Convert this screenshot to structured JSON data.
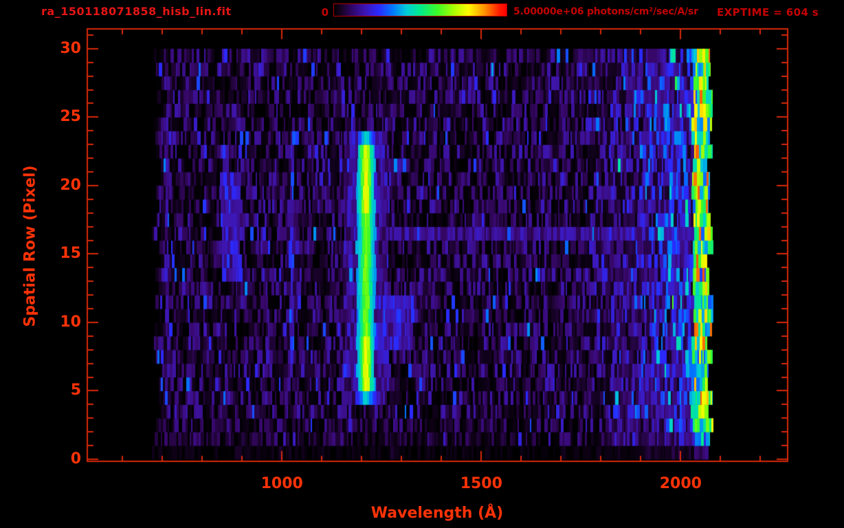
{
  "colors": {
    "background": "#000000",
    "axis": "#d8280a",
    "tick_label": "#fb3208",
    "title": "#e51515",
    "annotation": "#c40202"
  },
  "chart_data": {
    "type": "heatmap",
    "title": "ra_150118071858_hisb_lin.fit",
    "xlabel": "Wavelength (Å)",
    "ylabel": "Spatial Row (Pixel)",
    "xlim": [
      510,
      2270
    ],
    "ylim": [
      -0.2,
      31.5
    ],
    "xticks_major": [
      1000,
      1500,
      2000
    ],
    "xticks_minor_step": 100,
    "xticks_minor_range": [
      600,
      2200
    ],
    "yticks_major": [
      0,
      5,
      10,
      15,
      20,
      25,
      30
    ],
    "yticks_minor_step": 1,
    "yticks_minor_range": [
      0,
      31
    ],
    "grid": false,
    "plot_background": "#000000",
    "colorbar": {
      "min_label": "0",
      "max_label": "5.00000e+06",
      "units": "photons/cm²/sec/A/sr",
      "palette": "rainbow (black-purple-blue-cyan-green-yellow-red)"
    },
    "exptime_label": "EXPTIME = 604 s",
    "data_extent": {
      "wavelength_min": 685,
      "wavelength_max": 2075,
      "row_min": 0,
      "row_max": 30
    },
    "features": [
      {
        "name": "bright-emission-line",
        "wavelength": 1211,
        "half_width_A": 23,
        "rows": [
          5,
          24
        ],
        "peak_color": "green-yellow",
        "note": "strong vertical emission line, cyan caps at ends, yellow cores near rows 6-9 and 19-23"
      },
      {
        "name": "faint-emission-line",
        "wavelength": 1026,
        "half_width_A": 5,
        "rows": [
          8,
          23
        ],
        "peak_color": "blue"
      },
      {
        "name": "faint-left-line",
        "wavelength": 712,
        "half_width_A": 4,
        "rows": [
          4,
          26
        ],
        "peak_color": "blue"
      },
      {
        "name": "mid-left-blue-blob",
        "wavelength_range": [
          848,
          898
        ],
        "rows": [
          14,
          21
        ],
        "peak_color": "blue"
      },
      {
        "name": "cyan-blob-right-of-line",
        "wavelength_range": [
          1230,
          1330
        ],
        "rows": [
          9,
          12
        ],
        "peak_color": "blue-cyan"
      },
      {
        "name": "row17-blue-streak",
        "wavelength_range": [
          1230,
          2030
        ],
        "rows": [
          17,
          17
        ],
        "peak_color": "blue"
      },
      {
        "name": "longwave-bright-band",
        "wavelength_range": [
          1760,
          2075
        ],
        "rows": [
          1,
          30
        ],
        "peak_color": "blue-cyan-green",
        "note": "brightness ramps up toward cutoff; green/yellow/red columns at 2040-2075"
      },
      {
        "name": "background-noise",
        "note": "horizontal row bands (1 pixel tall) of speckled black/purple/violet/blue vertical bars"
      }
    ],
    "noise_seed": 1234
  }
}
